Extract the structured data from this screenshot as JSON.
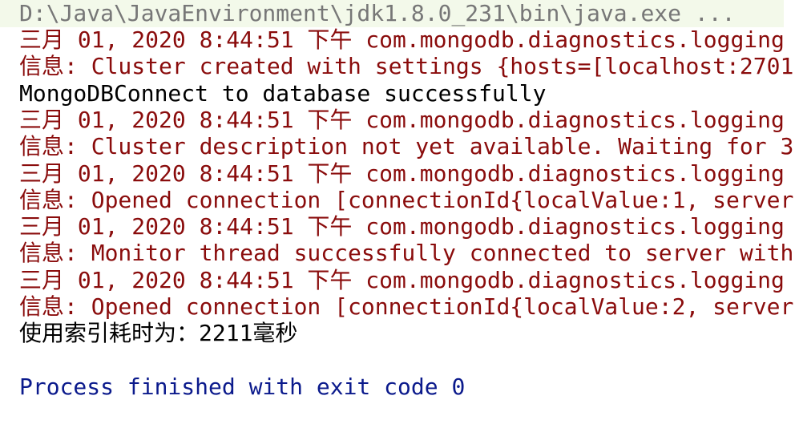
{
  "console": {
    "command_line": "D:\\Java\\JavaEnvironment\\jdk1.8.0_231\\bin\\java.exe ...",
    "lines": [
      {
        "type": "err",
        "text": "三月 01, 2020 8:44:51 下午 com.mongodb.diagnostics.logging"
      },
      {
        "type": "err",
        "text": "信息: Cluster created with settings {hosts=[localhost:2701"
      },
      {
        "type": "out",
        "text": "MongoDBConnect to database successfully"
      },
      {
        "type": "err",
        "text": "三月 01, 2020 8:44:51 下午 com.mongodb.diagnostics.logging"
      },
      {
        "type": "err",
        "text": "信息: Cluster description not yet available. Waiting for 3"
      },
      {
        "type": "err",
        "text": "三月 01, 2020 8:44:51 下午 com.mongodb.diagnostics.logging"
      },
      {
        "type": "err",
        "text": "信息: Opened connection [connectionId{localValue:1, server"
      },
      {
        "type": "err",
        "text": "三月 01, 2020 8:44:51 下午 com.mongodb.diagnostics.logging"
      },
      {
        "type": "err",
        "text": "信息: Monitor thread successfully connected to server with"
      },
      {
        "type": "err",
        "text": "三月 01, 2020 8:44:51 下午 com.mongodb.diagnostics.logging"
      },
      {
        "type": "err",
        "text": "信息: Opened connection [connectionId{localValue:2, server"
      },
      {
        "type": "out",
        "text": "使用索引耗时为：2211毫秒"
      }
    ],
    "exit_message": "Process finished with exit code 0"
  },
  "colors": {
    "background": "#ffffff",
    "command_text": "#777777",
    "command_highlight": "#f3f9ea",
    "stderr_text": "#8a0c0c",
    "stdout_text": "#000000",
    "exit_text": "#0b1a8c"
  }
}
